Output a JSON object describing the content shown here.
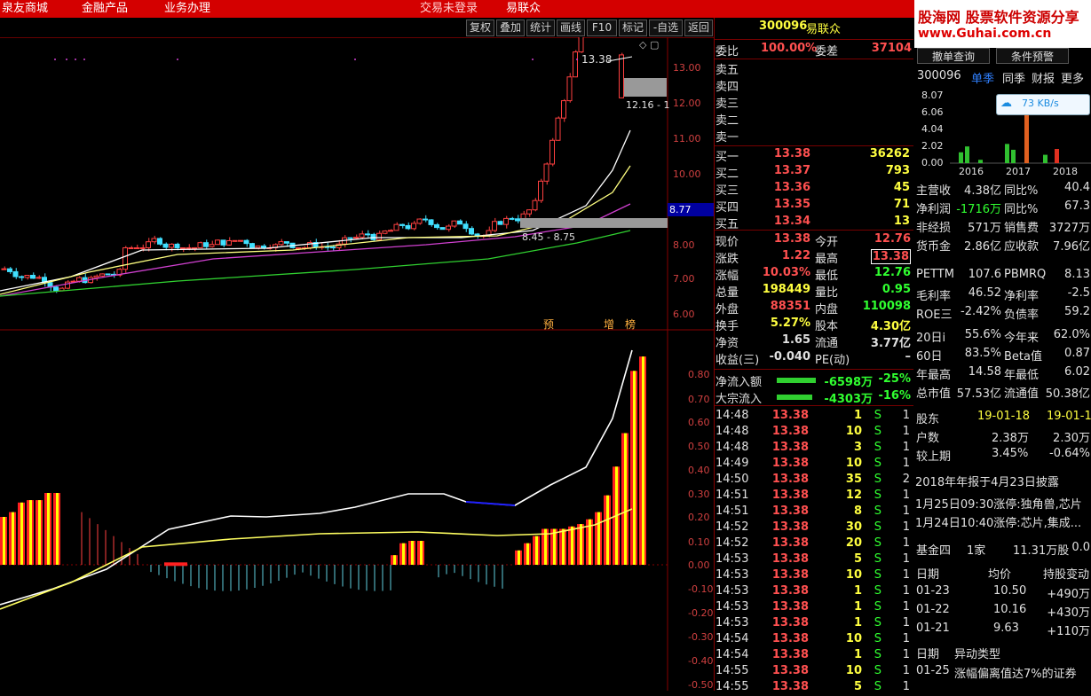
{
  "top_menu": [
    "泉友商城",
    "金融产品",
    "业务办理",
    "交易未登录",
    "易联众"
  ],
  "toolbar": [
    "复权",
    "叠加",
    "统计",
    "画线",
    "F10",
    "标记",
    "-自选",
    "返回"
  ],
  "chart": {
    "price_ticks": [
      "13.00",
      "12.00",
      "11.00",
      "10.00",
      "9.00",
      "8.00",
      "7.00",
      "6.00"
    ],
    "macd_ticks": [
      "0.80",
      "0.70",
      "0.60",
      "0.50",
      "0.40",
      "0.30",
      "0.20",
      "0.10",
      "0.00",
      "-0.10",
      "-0.20",
      "-0.30",
      "-0.40",
      "-0.50"
    ],
    "high_label": "13.38",
    "range_label": "12.16 - 1",
    "left_range": "8.45 - 8.75",
    "current_tag": "8.77",
    "markers": [
      "预",
      "增",
      "榜"
    ]
  },
  "quote": {
    "code": "300096",
    "name": "易联众",
    "weibi_label": "委比",
    "weibi": "100.00%",
    "weicha_label": "委差",
    "weicha": "37104",
    "sell": [
      {
        "label": "卖五"
      },
      {
        "label": "卖四"
      },
      {
        "label": "卖三"
      },
      {
        "label": "卖二"
      },
      {
        "label": "卖一"
      }
    ],
    "buy": [
      {
        "label": "买一",
        "price": "13.38",
        "vol": "36262"
      },
      {
        "label": "买二",
        "price": "13.37",
        "vol": "793"
      },
      {
        "label": "买三",
        "price": "13.36",
        "vol": "45"
      },
      {
        "label": "买四",
        "price": "13.35",
        "vol": "71"
      },
      {
        "label": "买五",
        "price": "13.34",
        "vol": "13"
      }
    ],
    "stats": [
      {
        "l1": "现价",
        "v1": "13.38",
        "l2": "今开",
        "v2": "12.76"
      },
      {
        "l1": "涨跌",
        "v1": "1.22",
        "l2": "最高",
        "v2": "13.38"
      },
      {
        "l1": "涨幅",
        "v1": "10.03%",
        "l2": "最低",
        "v2": "12.76"
      },
      {
        "l1": "总量",
        "v1": "198449",
        "l2": "量比",
        "v2": "0.95"
      },
      {
        "l1": "外盘",
        "v1": "88351",
        "l2": "内盘",
        "v2": "110098"
      },
      {
        "l1": "换手",
        "v1": "5.27%",
        "l2": "股本",
        "v2": "4.30亿"
      },
      {
        "l1": "净资",
        "v1": "1.65",
        "l2": "流通",
        "v2": "3.77亿"
      },
      {
        "l1": "收益(三)",
        "v1": "-0.040",
        "l2": "PE(动)",
        "v2": "–"
      }
    ],
    "flows": [
      {
        "label": "净流入额",
        "value": "-6598万",
        "pct": "-25%"
      },
      {
        "label": "大宗流入",
        "value": "-4303万",
        "pct": "-16%"
      }
    ],
    "ticks": [
      {
        "t": "14:48",
        "p": "13.38",
        "v": "1",
        "s": "S",
        "n": "1"
      },
      {
        "t": "14:48",
        "p": "13.38",
        "v": "10",
        "s": "S",
        "n": "1"
      },
      {
        "t": "14:48",
        "p": "13.38",
        "v": "3",
        "s": "S",
        "n": "1"
      },
      {
        "t": "14:49",
        "p": "13.38",
        "v": "10",
        "s": "S",
        "n": "1"
      },
      {
        "t": "14:50",
        "p": "13.38",
        "v": "35",
        "s": "S",
        "n": "2"
      },
      {
        "t": "14:51",
        "p": "13.38",
        "v": "12",
        "s": "S",
        "n": "1"
      },
      {
        "t": "14:51",
        "p": "13.38",
        "v": "8",
        "s": "S",
        "n": "1"
      },
      {
        "t": "14:52",
        "p": "13.38",
        "v": "30",
        "s": "S",
        "n": "1"
      },
      {
        "t": "14:52",
        "p": "13.38",
        "v": "20",
        "s": "S",
        "n": "1"
      },
      {
        "t": "14:53",
        "p": "13.38",
        "v": "5",
        "s": "S",
        "n": "1"
      },
      {
        "t": "14:53",
        "p": "13.38",
        "v": "10",
        "s": "S",
        "n": "1"
      },
      {
        "t": "14:53",
        "p": "13.38",
        "v": "1",
        "s": "S",
        "n": "1"
      },
      {
        "t": "14:53",
        "p": "13.38",
        "v": "1",
        "s": "S",
        "n": "1"
      },
      {
        "t": "14:53",
        "p": "13.38",
        "v": "1",
        "s": "S",
        "n": "1"
      },
      {
        "t": "14:54",
        "p": "13.38",
        "v": "10",
        "s": "S",
        "n": "1"
      },
      {
        "t": "14:54",
        "p": "13.38",
        "v": "1",
        "s": "S",
        "n": "1"
      },
      {
        "t": "14:55",
        "p": "13.38",
        "v": "10",
        "s": "S",
        "n": "1"
      },
      {
        "t": "14:55",
        "p": "13.38",
        "v": "5",
        "s": "S",
        "n": "1"
      }
    ]
  },
  "fundamentals": {
    "watermark": "股海网 股票软件资源分享",
    "watermark_url": "www.Guhai.com.cn",
    "btn1": "撤单查询",
    "btn2": "条件预警",
    "code": "300096",
    "tabs": [
      "单季",
      "同季",
      "财报",
      "更多"
    ],
    "net_speed": "73 KB/s",
    "bar_yticks": [
      "8.07",
      "6.06",
      "4.04",
      "2.02",
      "0.00"
    ],
    "bar_years": [
      "2016",
      "2017",
      "2018"
    ],
    "bar_values": [
      1.3,
      2.0,
      0.4,
      0.0,
      2.3,
      1.6,
      8.07,
      0.0,
      1.0,
      1.7
    ],
    "rows": [
      {
        "l": "主营收",
        "v": "4.38亿",
        "l2": "同比%",
        "v2": "40.4"
      },
      {
        "l": "净利润",
        "v": "-1716万",
        "l2": "同比%",
        "v2": "67.3"
      },
      {
        "l": "非经损",
        "v": "571万",
        "l2": "销售费",
        "v2": "3727万"
      },
      {
        "l": "货币金",
        "v": "2.86亿",
        "l2": "应收款",
        "v2": "7.96亿"
      }
    ],
    "rows2": [
      {
        "l": "PETTM",
        "v": "107.6",
        "l2": "PBMRQ",
        "v2": "8.13"
      },
      {
        "l": "毛利率",
        "v": "46.52",
        "l2": "净利率",
        "v2": "-2.5"
      },
      {
        "l": "ROE三",
        "v": "-2.42%",
        "l2": "负债率",
        "v2": "59.2"
      }
    ],
    "rows3": [
      {
        "l": "20日i",
        "v": "55.6%",
        "l2": "今年来",
        "v2": "62.0%"
      },
      {
        "l": "60日",
        "v": "83.5%",
        "l2": "Beta值",
        "v2": "0.87"
      },
      {
        "l": "年最高",
        "v": "14.58",
        "l2": "年最低",
        "v2": "6.02"
      },
      {
        "l": "总市值",
        "v": "57.53亿",
        "l2": "流通值",
        "v2": "50.38亿"
      }
    ],
    "holders": {
      "l": "股东",
      "d1": "19-01-18",
      "d2": "19-01-1",
      "r1l": "户数",
      "r1v": "2.38万",
      "r1v2": "2.30万",
      "r2l": "较上期",
      "r2v": "3.45%",
      "r2v2": "-0.64%"
    },
    "report": "2018年年报于4月23日披露",
    "news": [
      "1月25日09:30涨停:独角兽,芯片",
      "1月24日10:40涨停:芯片,集成..."
    ],
    "fund": {
      "l": "基金四",
      "v": "1家",
      "v2": "11.31万股",
      "v3": "0.0"
    },
    "daily_head": [
      "日期",
      "均价",
      "持股变动"
    ],
    "daily": [
      {
        "d": "01-23",
        "p": "10.50",
        "c": "+490万"
      },
      {
        "d": "01-22",
        "p": "10.16",
        "c": "+430万"
      },
      {
        "d": "01-21",
        "p": "9.63",
        "c": "+110万"
      }
    ],
    "anomaly_head": [
      "日期",
      "异动类型"
    ],
    "anomaly": {
      "d": "01-25",
      "t": "涨幅偏离值达7%的证券"
    }
  }
}
